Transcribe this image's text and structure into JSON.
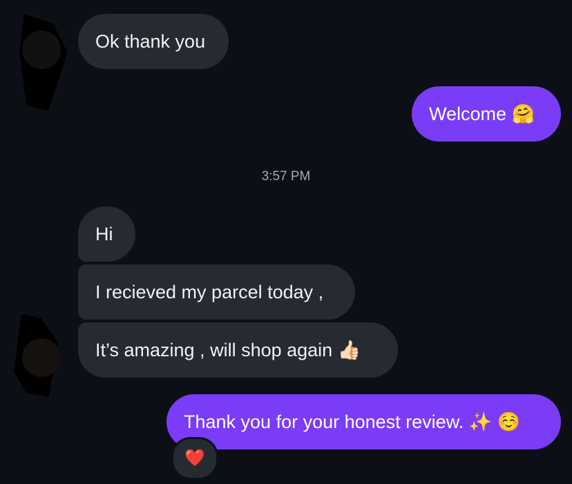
{
  "messages": {
    "m1": "Ok thank you",
    "m2": "Welcome 🤗",
    "timestamp": "3:57 PM",
    "m3": "Hi",
    "m4": "I recieved my parcel today ,",
    "m5": "It’s amazing , will shop again 👍🏻",
    "m6": "Thank you for your honest review. ✨ ☺️"
  },
  "reaction": "❤️",
  "colors": {
    "background": "#0c1016",
    "incoming_bubble": "#262a31",
    "outgoing_bubble": "#7a3cf7",
    "timestamp_text": "#a6a9b1"
  },
  "icons": {
    "avatar_top": "contact-avatar",
    "avatar_bottom": "contact-avatar",
    "reaction": "heart-reaction-icon"
  }
}
